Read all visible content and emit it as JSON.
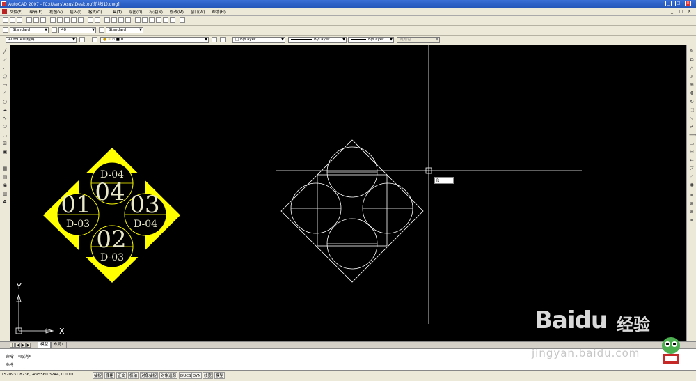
{
  "window": {
    "title": "AutoCAD 2007 - [C:\\Users\\Asus\\Desktop\\新块(1).dwg]",
    "controls": [
      "_",
      "□",
      "×"
    ]
  },
  "menu": {
    "items": [
      "文件(F)",
      "编辑(E)",
      "视图(V)",
      "插入(I)",
      "格式(O)",
      "工具(T)",
      "绘图(D)",
      "标注(N)",
      "修改(M)",
      "窗口(W)",
      "帮助(H)"
    ],
    "mdi_controls": [
      "_",
      "□",
      "×"
    ]
  },
  "styles_toolbar": {
    "text_style": "Standard",
    "dim_style": "40",
    "table_style": "Standard"
  },
  "layers_toolbar": {
    "workspace": "AutoCAD 经典",
    "current_layer": "0",
    "color": "ByLayer",
    "linetype": "ByLayer",
    "lineweight": "ByLayer",
    "plot_style": "随颜色"
  },
  "drawing": {
    "labels_yellow": {
      "top_small": "D-04",
      "top_big": "04",
      "left_big": "01",
      "left_small": "D-03",
      "right_big": "03",
      "right_small": "D-04",
      "bottom_big": "02",
      "bottom_small": "D-03"
    },
    "ucs": {
      "y_label": "Y",
      "x_label": "X"
    },
    "dynamic_input": "R",
    "colors": {
      "highlight": "#ffff00",
      "lines": "#ffffff",
      "background": "#000000"
    }
  },
  "tabs": {
    "nav": [
      "|◀",
      "◀",
      "▶",
      "▶|"
    ],
    "items": [
      "模型",
      "布局1"
    ]
  },
  "command": {
    "line1": "命令：*取消*",
    "line2": "命令："
  },
  "status": {
    "coords": "1520931.8236, -495560.3244, 0.0000",
    "buttons": [
      "捕捉",
      "栅格",
      "正交",
      "极轴",
      "对象捕捉",
      "对象追踪",
      "DUCS",
      "DYN",
      "线宽",
      "模型"
    ]
  },
  "watermark": {
    "logo_a": "Bai",
    "logo_b": "du",
    "logo_cn": "经验",
    "url": "jingyan.baidu.com"
  }
}
